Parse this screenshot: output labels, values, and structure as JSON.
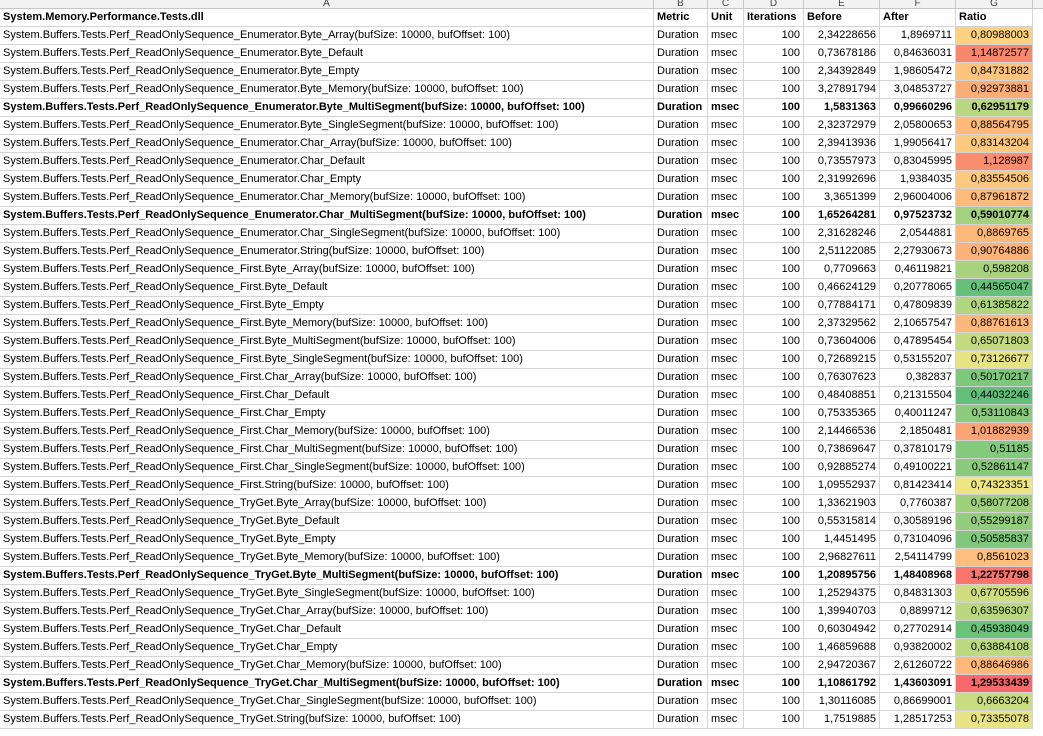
{
  "columns": [
    "A",
    "B",
    "C",
    "D",
    "E",
    "F",
    "G"
  ],
  "header": {
    "name": "System.Memory.Performance.Tests.dll",
    "metric": "Metric",
    "unit": "Unit",
    "iterations": "Iterations",
    "before": "Before",
    "after": "After",
    "ratio": "Ratio"
  },
  "rows": [
    {
      "name": "System.Buffers.Tests.Perf_ReadOnlySequence_Enumerator.Byte_Array(bufSize: 10000, bufOffset: 100)",
      "metric": "Duration",
      "unit": "msec",
      "iterations": "100",
      "before": "2,34228656",
      "after": "1,8969711",
      "ratio": "0,80988003",
      "bold": false,
      "color": "#fcd280"
    },
    {
      "name": "System.Buffers.Tests.Perf_ReadOnlySequence_Enumerator.Byte_Default",
      "metric": "Duration",
      "unit": "msec",
      "iterations": "100",
      "before": "0,73678186",
      "after": "0,84636031",
      "ratio": "1,14872577",
      "bold": false,
      "color": "#f8886d"
    },
    {
      "name": "System.Buffers.Tests.Perf_ReadOnlySequence_Enumerator.Byte_Empty",
      "metric": "Duration",
      "unit": "msec",
      "iterations": "100",
      "before": "2,34392849",
      "after": "1,98605472",
      "ratio": "0,84731882",
      "bold": false,
      "color": "#fcc47d"
    },
    {
      "name": "System.Buffers.Tests.Perf_ReadOnlySequence_Enumerator.Byte_Memory(bufSize: 10000, bufOffset: 100)",
      "metric": "Duration",
      "unit": "msec",
      "iterations": "100",
      "before": "3,27891794",
      "after": "3,04853727",
      "ratio": "0,92973881",
      "bold": false,
      "color": "#fbad78"
    },
    {
      "name": "System.Buffers.Tests.Perf_ReadOnlySequence_Enumerator.Byte_MultiSegment(bufSize: 10000, bufOffset: 100)",
      "metric": "Duration",
      "unit": "msec",
      "iterations": "100",
      "before": "1,5831363",
      "after": "0,99660296",
      "ratio": "0,62951179",
      "bold": true,
      "color": "#b8d780"
    },
    {
      "name": "System.Buffers.Tests.Perf_ReadOnlySequence_Enumerator.Byte_SingleSegment(bufSize: 10000, bufOffset: 100)",
      "metric": "Duration",
      "unit": "msec",
      "iterations": "100",
      "before": "2,32372979",
      "after": "2,05800653",
      "ratio": "0,88564795",
      "bold": false,
      "color": "#fcb97a"
    },
    {
      "name": "System.Buffers.Tests.Perf_ReadOnlySequence_Enumerator.Char_Array(bufSize: 10000, bufOffset: 100)",
      "metric": "Duration",
      "unit": "msec",
      "iterations": "100",
      "before": "2,39413936",
      "after": "1,99056417",
      "ratio": "0,83143204",
      "bold": false,
      "color": "#fcc97e"
    },
    {
      "name": "System.Buffers.Tests.Perf_ReadOnlySequence_Enumerator.Char_Default",
      "metric": "Duration",
      "unit": "msec",
      "iterations": "100",
      "before": "0,73557973",
      "after": "0,83045995",
      "ratio": "1,128987",
      "bold": false,
      "color": "#f98e6f"
    },
    {
      "name": "System.Buffers.Tests.Perf_ReadOnlySequence_Enumerator.Char_Empty",
      "metric": "Duration",
      "unit": "msec",
      "iterations": "100",
      "before": "2,31992696",
      "after": "1,9384035",
      "ratio": "0,83554506",
      "bold": false,
      "color": "#fcc87e"
    },
    {
      "name": "System.Buffers.Tests.Perf_ReadOnlySequence_Enumerator.Char_Memory(bufSize: 10000, bufOffset: 100)",
      "metric": "Duration",
      "unit": "msec",
      "iterations": "100",
      "before": "3,3651399",
      "after": "2,96004006",
      "ratio": "0,87961872",
      "bold": false,
      "color": "#fcbb7b"
    },
    {
      "name": "System.Buffers.Tests.Perf_ReadOnlySequence_Enumerator.Char_MultiSegment(bufSize: 10000, bufOffset: 100)",
      "metric": "Duration",
      "unit": "msec",
      "iterations": "100",
      "before": "1,65264281",
      "after": "0,97523732",
      "ratio": "0,59010774",
      "bold": true,
      "color": "#a5d17e"
    },
    {
      "name": "System.Buffers.Tests.Perf_ReadOnlySequence_Enumerator.Char_SingleSegment(bufSize: 10000, bufOffset: 100)",
      "metric": "Duration",
      "unit": "msec",
      "iterations": "100",
      "before": "2,31628246",
      "after": "2,0544881",
      "ratio": "0,8869765",
      "bold": false,
      "color": "#fcb97a"
    },
    {
      "name": "System.Buffers.Tests.Perf_ReadOnlySequence_Enumerator.String(bufSize: 10000, bufOffset: 100)",
      "metric": "Duration",
      "unit": "msec",
      "iterations": "100",
      "before": "2,51122085",
      "after": "2,27930673",
      "ratio": "0,90764886",
      "bold": false,
      "color": "#fbb379"
    },
    {
      "name": "System.Buffers.Tests.Perf_ReadOnlySequence_First.Byte_Array(bufSize: 10000, bufOffset: 100)",
      "metric": "Duration",
      "unit": "msec",
      "iterations": "100",
      "before": "0,7709663",
      "after": "0,46119821",
      "ratio": "0,598208",
      "bold": false,
      "color": "#a9d27f"
    },
    {
      "name": "System.Buffers.Tests.Perf_ReadOnlySequence_First.Byte_Default",
      "metric": "Duration",
      "unit": "msec",
      "iterations": "100",
      "before": "0,46624129",
      "after": "0,20778065",
      "ratio": "0,44565047",
      "bold": false,
      "color": "#66c07b"
    },
    {
      "name": "System.Buffers.Tests.Perf_ReadOnlySequence_First.Byte_Empty",
      "metric": "Duration",
      "unit": "msec",
      "iterations": "100",
      "before": "0,77884171",
      "after": "0,47809839",
      "ratio": "0,61385822",
      "bold": false,
      "color": "#b1d580"
    },
    {
      "name": "System.Buffers.Tests.Perf_ReadOnlySequence_First.Byte_Memory(bufSize: 10000, bufOffset: 100)",
      "metric": "Duration",
      "unit": "msec",
      "iterations": "100",
      "before": "2,37329562",
      "after": "2,10657547",
      "ratio": "0,88761613",
      "bold": false,
      "color": "#fcb87a"
    },
    {
      "name": "System.Buffers.Tests.Perf_ReadOnlySequence_First.Byte_MultiSegment(bufSize: 10000, bufOffset: 100)",
      "metric": "Duration",
      "unit": "msec",
      "iterations": "100",
      "before": "0,73604006",
      "after": "0,47895454",
      "ratio": "0,65071803",
      "bold": false,
      "color": "#c3da81"
    },
    {
      "name": "System.Buffers.Tests.Perf_ReadOnlySequence_First.Byte_SingleSegment(bufSize: 10000, bufOffset: 100)",
      "metric": "Duration",
      "unit": "msec",
      "iterations": "100",
      "before": "0,72689215",
      "after": "0,53155207",
      "ratio": "0,73126677",
      "bold": false,
      "color": "#e7e483"
    },
    {
      "name": "System.Buffers.Tests.Perf_ReadOnlySequence_First.Char_Array(bufSize: 10000, bufOffset: 100)",
      "metric": "Duration",
      "unit": "msec",
      "iterations": "100",
      "before": "0,76307623",
      "after": "0,382837",
      "ratio": "0,50170217",
      "bold": false,
      "color": "#7fc77c"
    },
    {
      "name": "System.Buffers.Tests.Perf_ReadOnlySequence_First.Char_Default",
      "metric": "Duration",
      "unit": "msec",
      "iterations": "100",
      "before": "0,48408851",
      "after": "0,21315504",
      "ratio": "0,44032246",
      "bold": false,
      "color": "#63be7b"
    },
    {
      "name": "System.Buffers.Tests.Perf_ReadOnlySequence_First.Char_Empty",
      "metric": "Duration",
      "unit": "msec",
      "iterations": "100",
      "before": "0,75335365",
      "after": "0,40011247",
      "ratio": "0,53110843",
      "bold": false,
      "color": "#8ccb7d"
    },
    {
      "name": "System.Buffers.Tests.Perf_ReadOnlySequence_First.Char_Memory(bufSize: 10000, bufOffset: 100)",
      "metric": "Duration",
      "unit": "msec",
      "iterations": "100",
      "before": "2,14466536",
      "after": "2,1850481",
      "ratio": "1,01882939",
      "bold": false,
      "color": "#faa575"
    },
    {
      "name": "System.Buffers.Tests.Perf_ReadOnlySequence_First.Char_MultiSegment(bufSize: 10000, bufOffset: 100)",
      "metric": "Duration",
      "unit": "msec",
      "iterations": "100",
      "before": "0,73869647",
      "after": "0,37810179",
      "ratio": "0,51185",
      "bold": false,
      "color": "#84c97c"
    },
    {
      "name": "System.Buffers.Tests.Perf_ReadOnlySequence_First.Char_SingleSegment(bufSize: 10000, bufOffset: 100)",
      "metric": "Duration",
      "unit": "msec",
      "iterations": "100",
      "before": "0,92885274",
      "after": "0,49100221",
      "ratio": "0,52861147",
      "bold": false,
      "color": "#8aca7d"
    },
    {
      "name": "System.Buffers.Tests.Perf_ReadOnlySequence_First.String(bufSize: 10000, bufOffset: 100)",
      "metric": "Duration",
      "unit": "msec",
      "iterations": "100",
      "before": "1,09552937",
      "after": "0,81423414",
      "ratio": "0,74323351",
      "bold": false,
      "color": "#ede683"
    },
    {
      "name": "System.Buffers.Tests.Perf_ReadOnlySequence_TryGet.Byte_Array(bufSize: 10000, bufOffset: 100)",
      "metric": "Duration",
      "unit": "msec",
      "iterations": "100",
      "before": "1,33621903",
      "after": "0,7760387",
      "ratio": "0,58077208",
      "bold": false,
      "color": "#a0cf7e"
    },
    {
      "name": "System.Buffers.Tests.Perf_ReadOnlySequence_TryGet.Byte_Default",
      "metric": "Duration",
      "unit": "msec",
      "iterations": "100",
      "before": "0,55315814",
      "after": "0,30589196",
      "ratio": "0,55299187",
      "bold": false,
      "color": "#95cd7e"
    },
    {
      "name": "System.Buffers.Tests.Perf_ReadOnlySequence_TryGet.Byte_Empty",
      "metric": "Duration",
      "unit": "msec",
      "iterations": "100",
      "before": "1,4451495",
      "after": "0,73104096",
      "ratio": "0,50585837",
      "bold": false,
      "color": "#81c87c"
    },
    {
      "name": "System.Buffers.Tests.Perf_ReadOnlySequence_TryGet.Byte_Memory(bufSize: 10000, bufOffset: 100)",
      "metric": "Duration",
      "unit": "msec",
      "iterations": "100",
      "before": "2,96827611",
      "after": "2,54114799",
      "ratio": "0,8561023",
      "bold": false,
      "color": "#fcc07c"
    },
    {
      "name": "System.Buffers.Tests.Perf_ReadOnlySequence_TryGet.Byte_MultiSegment(bufSize: 10000, bufOffset: 100)",
      "metric": "Duration",
      "unit": "msec",
      "iterations": "100",
      "before": "1,20895756",
      "after": "1,48408968",
      "ratio": "1,22757798",
      "bold": true,
      "color": "#f8766d"
    },
    {
      "name": "System.Buffers.Tests.Perf_ReadOnlySequence_TryGet.Byte_SingleSegment(bufSize: 10000, bufOffset: 100)",
      "metric": "Duration",
      "unit": "msec",
      "iterations": "100",
      "before": "1,25294375",
      "after": "0,84831303",
      "ratio": "0,67705596",
      "bold": false,
      "color": "#cfdd82"
    },
    {
      "name": "System.Buffers.Tests.Perf_ReadOnlySequence_TryGet.Char_Array(bufSize: 10000, bufOffset: 100)",
      "metric": "Duration",
      "unit": "msec",
      "iterations": "100",
      "before": "1,39940703",
      "after": "0,8899712",
      "ratio": "0,63596307",
      "bold": false,
      "color": "#bbd880"
    },
    {
      "name": "System.Buffers.Tests.Perf_ReadOnlySequence_TryGet.Char_Default",
      "metric": "Duration",
      "unit": "msec",
      "iterations": "100",
      "before": "0,60304942",
      "after": "0,27702914",
      "ratio": "0,45938049",
      "bold": false,
      "color": "#6bc27b"
    },
    {
      "name": "System.Buffers.Tests.Perf_ReadOnlySequence_TryGet.Char_Empty",
      "metric": "Duration",
      "unit": "msec",
      "iterations": "100",
      "before": "1,46859688",
      "after": "0,93820002",
      "ratio": "0,63884108",
      "bold": false,
      "color": "#bcd880"
    },
    {
      "name": "System.Buffers.Tests.Perf_ReadOnlySequence_TryGet.Char_Memory(bufSize: 10000, bufOffset: 100)",
      "metric": "Duration",
      "unit": "msec",
      "iterations": "100",
      "before": "2,94720367",
      "after": "2,61260722",
      "ratio": "0,88646986",
      "bold": false,
      "color": "#fcb97a"
    },
    {
      "name": "System.Buffers.Tests.Perf_ReadOnlySequence_TryGet.Char_MultiSegment(bufSize: 10000, bufOffset: 100)",
      "metric": "Duration",
      "unit": "msec",
      "iterations": "100",
      "before": "1,10861792",
      "after": "1,43603091",
      "ratio": "1,29533439",
      "bold": true,
      "color": "#f8696b"
    },
    {
      "name": "System.Buffers.Tests.Perf_ReadOnlySequence_TryGet.Char_SingleSegment(bufSize: 10000, bufOffset: 100)",
      "metric": "Duration",
      "unit": "msec",
      "iterations": "100",
      "before": "1,30116085",
      "after": "0,86699001",
      "ratio": "0,6663204",
      "bold": false,
      "color": "#cadc81"
    },
    {
      "name": "System.Buffers.Tests.Perf_ReadOnlySequence_TryGet.String(bufSize: 10000, bufOffset: 100)",
      "metric": "Duration",
      "unit": "msec",
      "iterations": "100",
      "before": "1,7519885",
      "after": "1,28517253",
      "ratio": "0,73355078",
      "bold": false,
      "color": "#e8e483"
    }
  ]
}
